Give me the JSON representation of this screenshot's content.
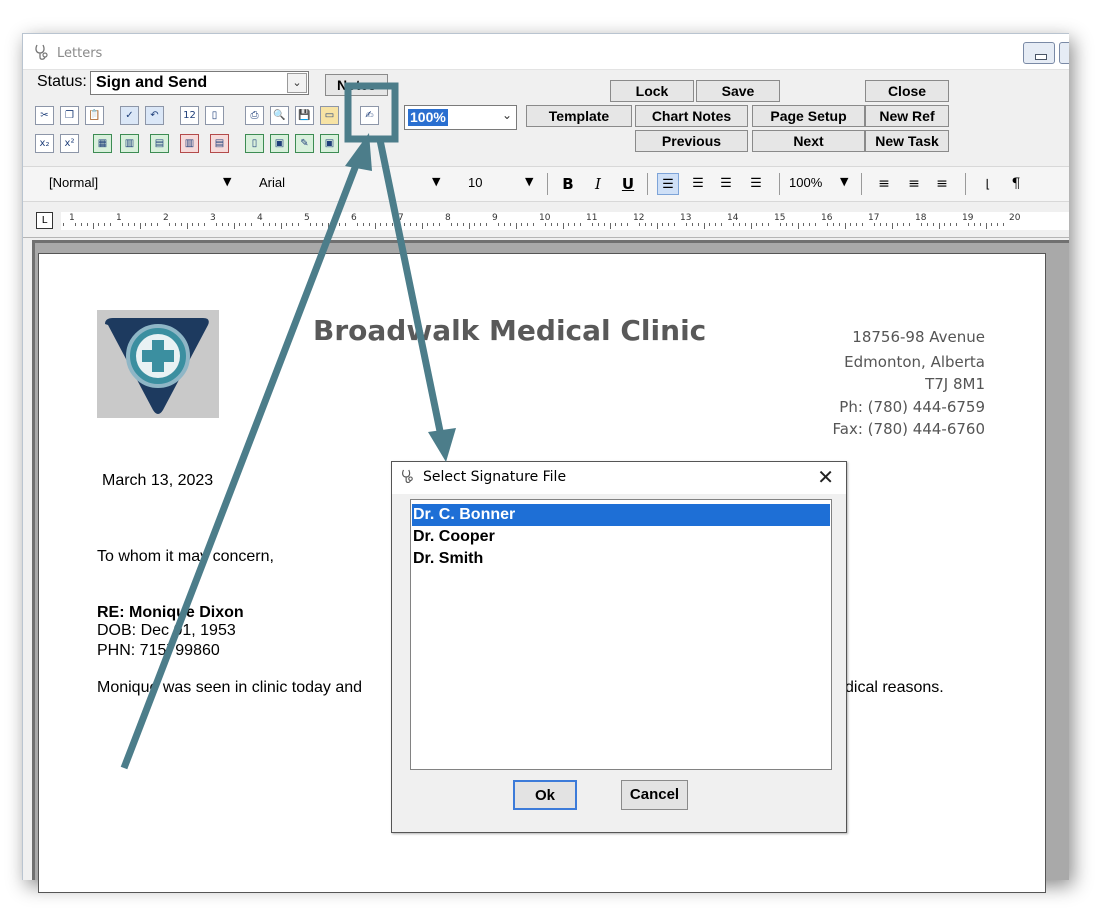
{
  "window": {
    "title": "Letters"
  },
  "status": {
    "label": "Status:",
    "value": "Sign and Send"
  },
  "buttons": {
    "notes": "Notes",
    "lock": "Lock",
    "save": "Save",
    "close": "Close",
    "template": "Template",
    "chart_notes": "Chart Notes",
    "page_setup": "Page Setup",
    "new_ref": "New Ref",
    "previous": "Previous",
    "next": "Next",
    "new_task": "New Task"
  },
  "zoom": {
    "value": "100%"
  },
  "format_bar": {
    "style": "[Normal]",
    "font": "Arial",
    "size": "10",
    "zoom": "100%"
  },
  "ruler": {
    "numbers": [
      "1",
      "1",
      "2",
      "3",
      "4",
      "5",
      "6",
      "7",
      "8",
      "9",
      "10",
      "11",
      "12",
      "13",
      "14",
      "15",
      "16",
      "17",
      "18",
      "19",
      "20"
    ]
  },
  "letter": {
    "clinic_name": "Broadwalk Medical Clinic",
    "address": [
      "18756-98 Avenue",
      "Edmonton, Alberta",
      "T7J 8M1",
      "Ph: (780) 444-6759",
      "Fax: (780) 444-6760"
    ],
    "date": "March 13, 2023",
    "salutation": "To whom it may concern,",
    "re": "RE: Monique Dixon",
    "dob": "DOB: Dec 01, 1953",
    "phn": "PHN: 715799860",
    "body_start": "Monique was seen in clinic today and",
    "body_end": "dical reasons."
  },
  "dialog": {
    "title": "Select Signature File",
    "items": [
      "Dr. C. Bonner",
      "Dr. Cooper",
      "Dr. Smith"
    ],
    "selected_index": 0,
    "ok": "Ok",
    "cancel": "Cancel"
  },
  "colors": {
    "annotation": "#4c7d8a",
    "selection": "#1e6fd6",
    "clinic_gray": "#595959"
  }
}
